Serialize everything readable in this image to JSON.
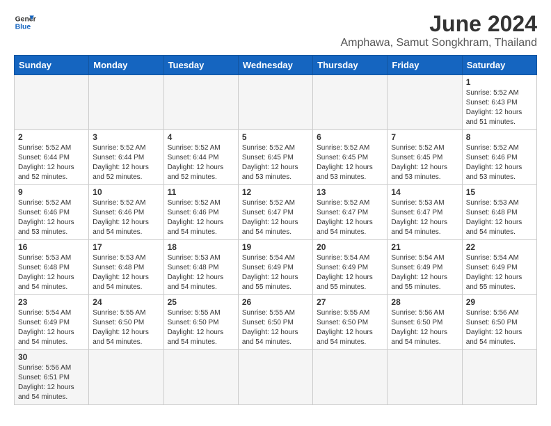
{
  "header": {
    "logo_general": "General",
    "logo_blue": "Blue",
    "title": "June 2024",
    "subtitle": "Amphawa, Samut Songkhram, Thailand"
  },
  "weekdays": [
    "Sunday",
    "Monday",
    "Tuesday",
    "Wednesday",
    "Thursday",
    "Friday",
    "Saturday"
  ],
  "weeks": [
    [
      {
        "day": "",
        "info": "",
        "empty": true
      },
      {
        "day": "",
        "info": "",
        "empty": true
      },
      {
        "day": "",
        "info": "",
        "empty": true
      },
      {
        "day": "",
        "info": "",
        "empty": true
      },
      {
        "day": "",
        "info": "",
        "empty": true
      },
      {
        "day": "",
        "info": "",
        "empty": true
      },
      {
        "day": "1",
        "info": "Sunrise: 5:52 AM\nSunset: 6:43 PM\nDaylight: 12 hours and 51 minutes."
      }
    ],
    [
      {
        "day": "2",
        "info": "Sunrise: 5:52 AM\nSunset: 6:44 PM\nDaylight: 12 hours and 52 minutes."
      },
      {
        "day": "3",
        "info": "Sunrise: 5:52 AM\nSunset: 6:44 PM\nDaylight: 12 hours and 52 minutes."
      },
      {
        "day": "4",
        "info": "Sunrise: 5:52 AM\nSunset: 6:44 PM\nDaylight: 12 hours and 52 minutes."
      },
      {
        "day": "5",
        "info": "Sunrise: 5:52 AM\nSunset: 6:45 PM\nDaylight: 12 hours and 53 minutes."
      },
      {
        "day": "6",
        "info": "Sunrise: 5:52 AM\nSunset: 6:45 PM\nDaylight: 12 hours and 53 minutes."
      },
      {
        "day": "7",
        "info": "Sunrise: 5:52 AM\nSunset: 6:45 PM\nDaylight: 12 hours and 53 minutes."
      },
      {
        "day": "8",
        "info": "Sunrise: 5:52 AM\nSunset: 6:46 PM\nDaylight: 12 hours and 53 minutes."
      }
    ],
    [
      {
        "day": "9",
        "info": "Sunrise: 5:52 AM\nSunset: 6:46 PM\nDaylight: 12 hours and 53 minutes."
      },
      {
        "day": "10",
        "info": "Sunrise: 5:52 AM\nSunset: 6:46 PM\nDaylight: 12 hours and 54 minutes."
      },
      {
        "day": "11",
        "info": "Sunrise: 5:52 AM\nSunset: 6:46 PM\nDaylight: 12 hours and 54 minutes."
      },
      {
        "day": "12",
        "info": "Sunrise: 5:52 AM\nSunset: 6:47 PM\nDaylight: 12 hours and 54 minutes."
      },
      {
        "day": "13",
        "info": "Sunrise: 5:52 AM\nSunset: 6:47 PM\nDaylight: 12 hours and 54 minutes."
      },
      {
        "day": "14",
        "info": "Sunrise: 5:53 AM\nSunset: 6:47 PM\nDaylight: 12 hours and 54 minutes."
      },
      {
        "day": "15",
        "info": "Sunrise: 5:53 AM\nSunset: 6:48 PM\nDaylight: 12 hours and 54 minutes."
      }
    ],
    [
      {
        "day": "16",
        "info": "Sunrise: 5:53 AM\nSunset: 6:48 PM\nDaylight: 12 hours and 54 minutes."
      },
      {
        "day": "17",
        "info": "Sunrise: 5:53 AM\nSunset: 6:48 PM\nDaylight: 12 hours and 54 minutes."
      },
      {
        "day": "18",
        "info": "Sunrise: 5:53 AM\nSunset: 6:48 PM\nDaylight: 12 hours and 54 minutes."
      },
      {
        "day": "19",
        "info": "Sunrise: 5:54 AM\nSunset: 6:49 PM\nDaylight: 12 hours and 55 minutes."
      },
      {
        "day": "20",
        "info": "Sunrise: 5:54 AM\nSunset: 6:49 PM\nDaylight: 12 hours and 55 minutes."
      },
      {
        "day": "21",
        "info": "Sunrise: 5:54 AM\nSunset: 6:49 PM\nDaylight: 12 hours and 55 minutes."
      },
      {
        "day": "22",
        "info": "Sunrise: 5:54 AM\nSunset: 6:49 PM\nDaylight: 12 hours and 55 minutes."
      }
    ],
    [
      {
        "day": "23",
        "info": "Sunrise: 5:54 AM\nSunset: 6:49 PM\nDaylight: 12 hours and 54 minutes."
      },
      {
        "day": "24",
        "info": "Sunrise: 5:55 AM\nSunset: 6:50 PM\nDaylight: 12 hours and 54 minutes."
      },
      {
        "day": "25",
        "info": "Sunrise: 5:55 AM\nSunset: 6:50 PM\nDaylight: 12 hours and 54 minutes."
      },
      {
        "day": "26",
        "info": "Sunrise: 5:55 AM\nSunset: 6:50 PM\nDaylight: 12 hours and 54 minutes."
      },
      {
        "day": "27",
        "info": "Sunrise: 5:55 AM\nSunset: 6:50 PM\nDaylight: 12 hours and 54 minutes."
      },
      {
        "day": "28",
        "info": "Sunrise: 5:56 AM\nSunset: 6:50 PM\nDaylight: 12 hours and 54 minutes."
      },
      {
        "day": "29",
        "info": "Sunrise: 5:56 AM\nSunset: 6:50 PM\nDaylight: 12 hours and 54 minutes."
      }
    ],
    [
      {
        "day": "30",
        "info": "Sunrise: 5:56 AM\nSunset: 6:51 PM\nDaylight: 12 hours and 54 minutes.",
        "last_row": true
      },
      {
        "day": "",
        "info": "",
        "empty": true,
        "last_row": true
      },
      {
        "day": "",
        "info": "",
        "empty": true,
        "last_row": true
      },
      {
        "day": "",
        "info": "",
        "empty": true,
        "last_row": true
      },
      {
        "day": "",
        "info": "",
        "empty": true,
        "last_row": true
      },
      {
        "day": "",
        "info": "",
        "empty": true,
        "last_row": true
      },
      {
        "day": "",
        "info": "",
        "empty": true,
        "last_row": true
      }
    ]
  ],
  "colors": {
    "header_bg": "#1565c0",
    "logo_blue": "#1565c0"
  }
}
